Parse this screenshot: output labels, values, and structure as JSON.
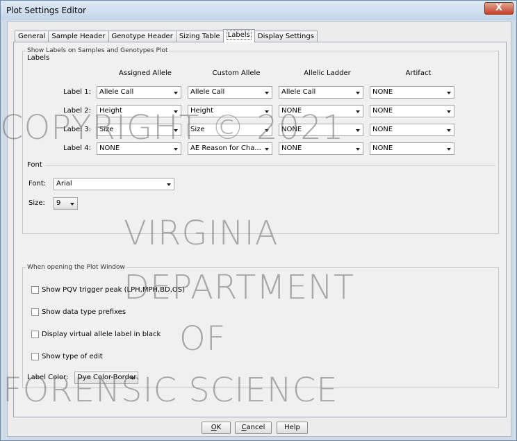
{
  "window": {
    "title": "Plot Settings Editor",
    "close_glyph": "X"
  },
  "tabs": [
    {
      "label": "General"
    },
    {
      "label": "Sample Header"
    },
    {
      "label": "Genotype Header"
    },
    {
      "label": "Sizing Table"
    },
    {
      "label": "Labels"
    },
    {
      "label": "Display Settings"
    }
  ],
  "labels_group": {
    "legend": "Show Labels on Samples and Genotypes Plot",
    "subhead": "Labels",
    "columns": [
      "Assigned Allele",
      "Custom Allele",
      "Allelic Ladder",
      "Artifact"
    ],
    "rows": [
      {
        "label": "Label 1:",
        "values": [
          "Allele Call",
          "Allele Call",
          "Allele Call",
          "NONE"
        ]
      },
      {
        "label": "Label 2:",
        "values": [
          "Height",
          "Height",
          "NONE",
          "NONE"
        ]
      },
      {
        "label": "Label 3:",
        "values": [
          "Size",
          "Size",
          "NONE",
          "NONE"
        ]
      },
      {
        "label": "Label 4:",
        "values": [
          "NONE",
          "AE Reason for Cha...",
          "NONE",
          "NONE"
        ]
      }
    ],
    "font_subhead": "Font",
    "font_label": "Font:",
    "font_value": "Arial",
    "size_label": "Size:",
    "size_value": "9"
  },
  "plot_window_group": {
    "legend": "When opening the Plot Window",
    "options": [
      {
        "label": "Show PQV trigger peak (LPH,MPH,BD,OS)",
        "checked": false
      },
      {
        "label": "Show data type prefixes",
        "checked": false
      },
      {
        "label": "Display virtual allele label in black",
        "checked": false
      },
      {
        "label": "Show type of edit",
        "checked": false
      }
    ],
    "label_color_label": "Label Color:",
    "label_color_value": "Dye Color-Border"
  },
  "buttons": {
    "ok_prefix": "",
    "ok_mnemonic": "O",
    "ok_rest": "K",
    "cancel_mnemonic": "C",
    "cancel_rest": "ancel",
    "help": "Help"
  },
  "watermark": {
    "line1": "COPYRIGHT © 2021",
    "line2": "VIRGINIA",
    "line3": "DEPARTMENT",
    "line4": "OF",
    "line5": "FORENSIC SCIENCE"
  }
}
